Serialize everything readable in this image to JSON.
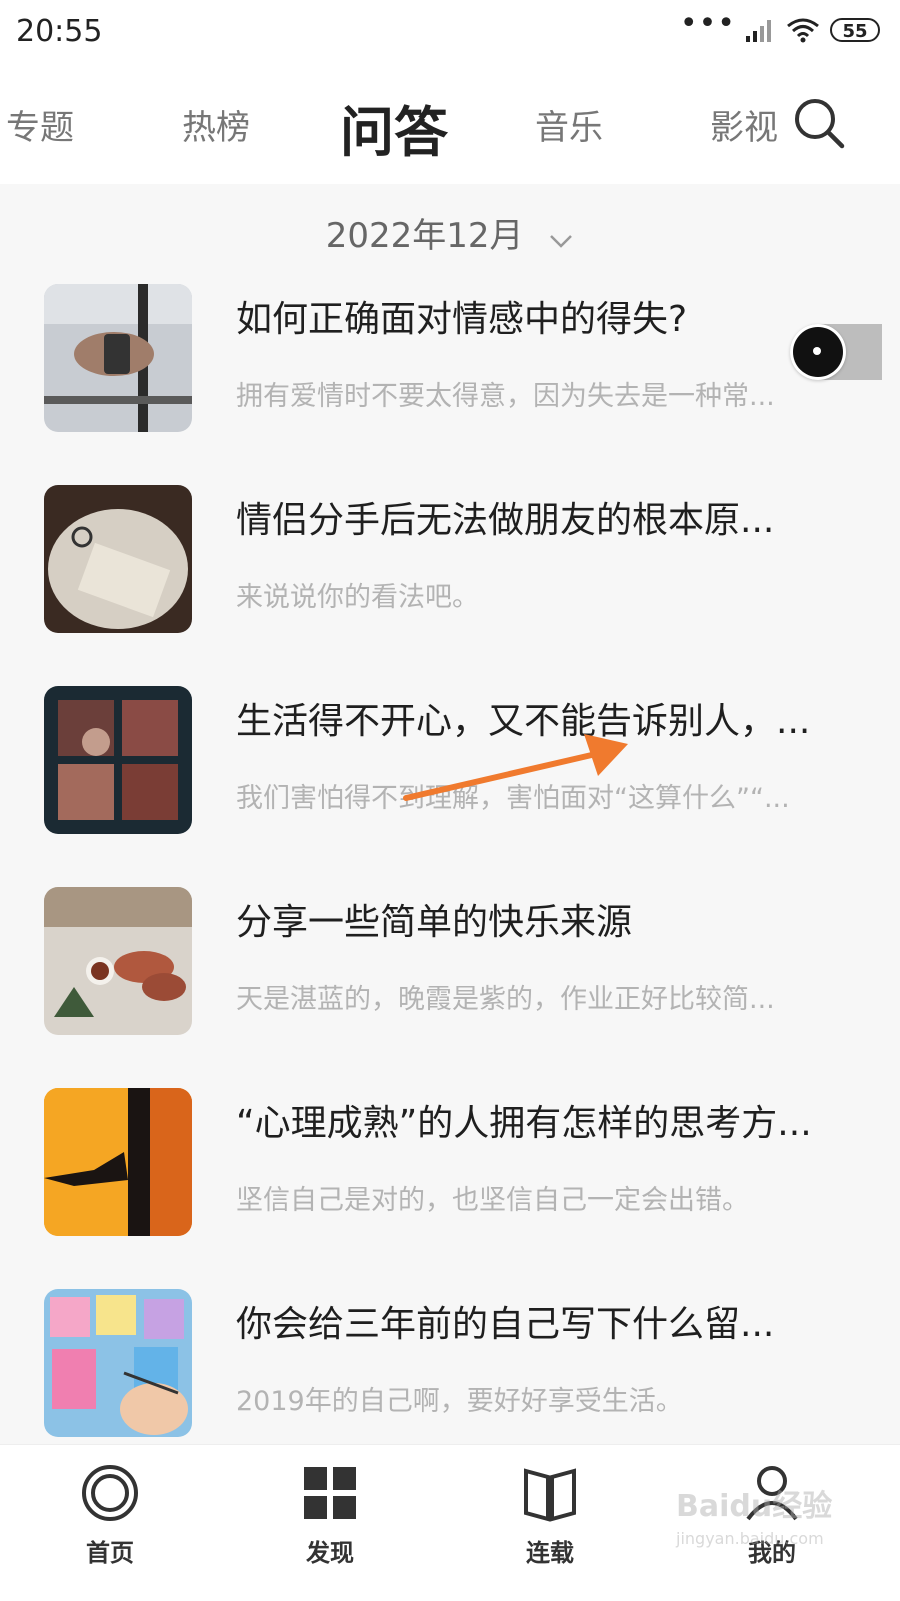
{
  "status_bar": {
    "time": "20:55",
    "battery": "55"
  },
  "top_tabs": [
    {
      "label": "专题",
      "active": false
    },
    {
      "label": "热榜",
      "active": false
    },
    {
      "label": "问答",
      "active": true
    },
    {
      "label": "音乐",
      "active": false
    },
    {
      "label": "影视",
      "active": false
    }
  ],
  "date_picker": {
    "label": "2022年12月"
  },
  "items": [
    {
      "title": "如何正确面对情感中的得失?",
      "subtitle": "拥有爱情时不要太得意，因为失去是一种常..."
    },
    {
      "title": "情侣分手后无法做朋友的根本原...",
      "subtitle": "来说说你的看法吧。"
    },
    {
      "title": "生活得不开心，又不能告诉别人，...",
      "subtitle": "我们害怕得不到理解，害怕面对“这算什么”“..."
    },
    {
      "title": "分享一些简单的快乐来源",
      "subtitle": "天是湛蓝的，晚霞是紫的，作业正好比较简..."
    },
    {
      "title": "“心理成熟”的人拥有怎样的思考方...",
      "subtitle": "坚信自己是对的，也坚信自己一定会出错。"
    },
    {
      "title": "你会给三年前的自己写下什么留...",
      "subtitle": "2019年的自己啊，要好好享受生活。"
    }
  ],
  "bottom_nav": [
    {
      "label": "首页",
      "icon": "home-icon"
    },
    {
      "label": "发现",
      "icon": "grid-icon"
    },
    {
      "label": "连载",
      "icon": "book-icon"
    },
    {
      "label": "我的",
      "icon": "user-icon"
    }
  ],
  "watermark": {
    "brand": "Baidu经验",
    "url": "jingyan.baidu.com"
  },
  "colors": {
    "annotation_arrow": "#f07a2e",
    "background": "#f7f7f7"
  }
}
